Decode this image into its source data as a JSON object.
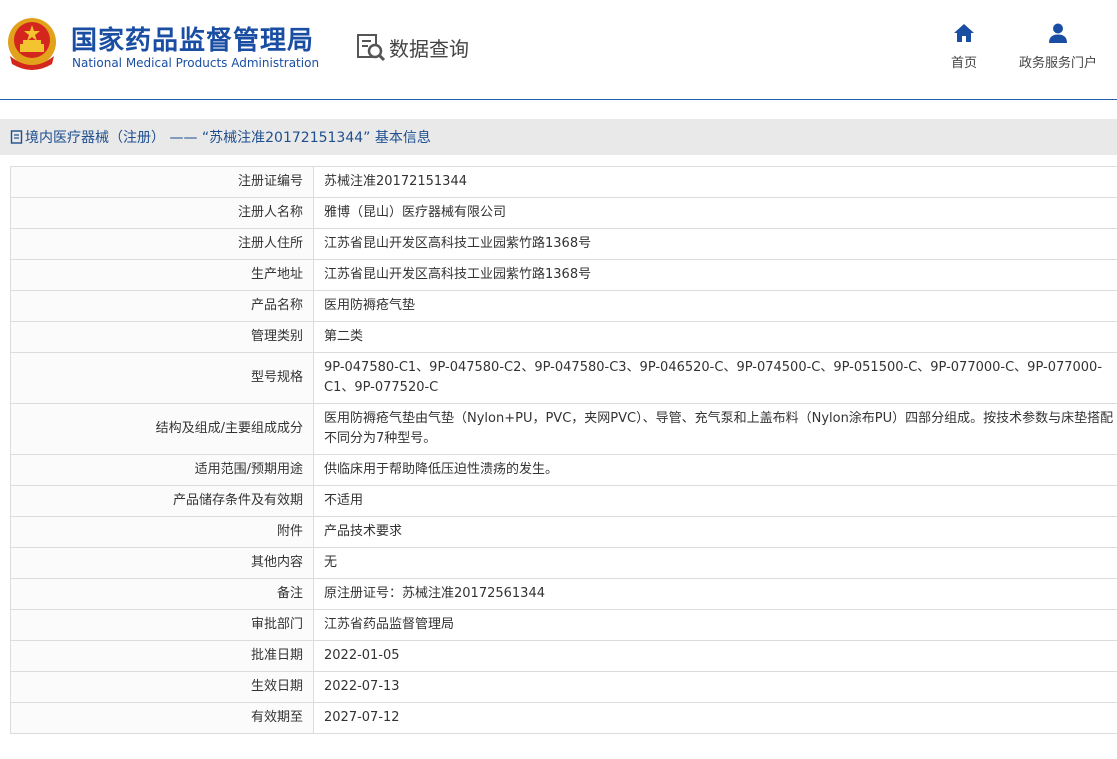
{
  "header": {
    "logo_cn": "国家药品监督管理局",
    "logo_en": "National Medical Products Administration",
    "query_label": "数据查询",
    "nav": [
      {
        "label": "首页",
        "icon": "home-icon"
      },
      {
        "label": "政务服务门户",
        "icon": "user-icon"
      }
    ]
  },
  "breadcrumb": {
    "text": "境内医疗器械（注册） —— “苏械注准20172151344” 基本信息"
  },
  "colors": {
    "brand": "#1a4ea3",
    "crumb_bg": "#e9e9e9",
    "border": "#dcdcdc"
  },
  "detail": {
    "rows": [
      {
        "label": "注册证编号",
        "value": "苏械注准20172151344"
      },
      {
        "label": "注册人名称",
        "value": "雅博（昆山）医疗器械有限公司"
      },
      {
        "label": "注册人住所",
        "value": "江苏省昆山开发区高科技工业园紫竹路1368号"
      },
      {
        "label": "生产地址",
        "value": "江苏省昆山开发区高科技工业园紫竹路1368号"
      },
      {
        "label": "产品名称",
        "value": "医用防褥疮气垫"
      },
      {
        "label": "管理类别",
        "value": "第二类"
      },
      {
        "label": "型号规格",
        "value": "9P-047580-C1、9P-047580-C2、9P-047580-C3、9P-046520-C、9P-074500-C、9P-051500-C、9P-077000-C、9P-077000-C1、9P-077520-C"
      },
      {
        "label": "结构及组成/主要组成成分",
        "value": "医用防褥疮气垫由气垫（Nylon+PU，PVC，夹网PVC）、导管、充气泵和上盖布料（Nylon涂布PU）四部分组成。按技术参数与床垫搭配不同分为7种型号。"
      },
      {
        "label": "适用范围/预期用途",
        "value": "供临床用于帮助降低压迫性溃疡的发生。"
      },
      {
        "label": "产品储存条件及有效期",
        "value": "不适用"
      },
      {
        "label": "附件",
        "value": "产品技术要求"
      },
      {
        "label": "其他内容",
        "value": "无"
      },
      {
        "label": "备注",
        "value": "原注册证号：苏械注准20172561344"
      },
      {
        "label": "审批部门",
        "value": "江苏省药品监督管理局"
      },
      {
        "label": "批准日期",
        "value": "2022-01-05"
      },
      {
        "label": "生效日期",
        "value": "2022-07-13"
      },
      {
        "label": "有效期至",
        "value": "2027-07-12"
      }
    ]
  }
}
